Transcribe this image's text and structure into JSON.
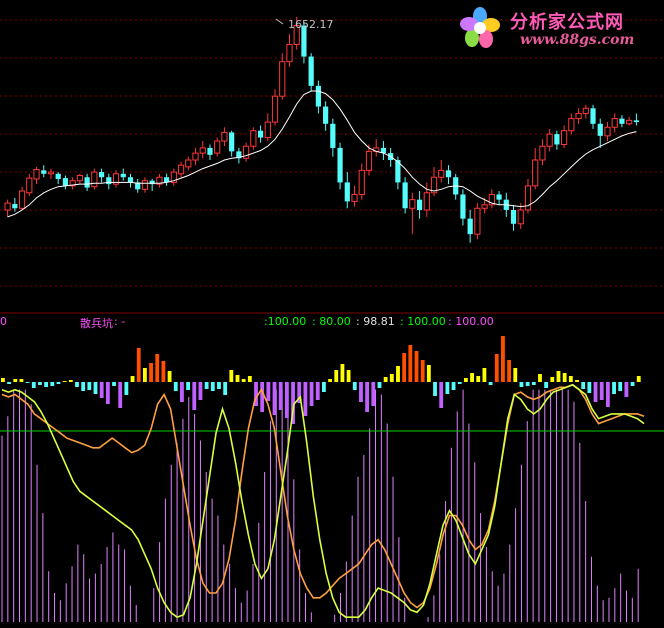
{
  "logo": {
    "title": "分析家公式网",
    "url": "www.88gs.com"
  },
  "price_panel": {
    "peak_label": "1652.17"
  },
  "indicator_header": {
    "left_value": "0",
    "name": "散兵坑",
    "sep": ": -",
    "values": [
      ":100.00",
      ": 80.00",
      ": 98.81",
      ": 100.00",
      ": 100.00"
    ]
  },
  "colors": {
    "up": "#ff3838",
    "down": "#54fcfc",
    "ma": "#ffffff",
    "grid": "#800000",
    "green_line": "#00d000",
    "bar_red": "#ff5000",
    "bar_yellow": "#ffff00",
    "bar_cyan": "#54fcfc",
    "bar_violet": "#c060ff",
    "histogram": "#e080ff",
    "line_yellow": "#d8ff40",
    "line_orange": "#ffa040",
    "hdr_name": "#ff50ff",
    "hdr_green": "#00ff00",
    "hdr_white": "#e0e0e0",
    "hdr_magenta": "#ff50ff"
  },
  "chart_data": [
    {
      "type": "candlestick",
      "title": "",
      "peak_annotation": 1652.17,
      "ylim": [
        1370,
        1660
      ],
      "candles": [
        [
          1428,
          1436,
          1420,
          1440
        ],
        [
          1435,
          1430,
          1426,
          1442
        ],
        [
          1430,
          1450,
          1428,
          1455
        ],
        [
          1448,
          1465,
          1444,
          1470
        ],
        [
          1464,
          1475,
          1458,
          1478
        ],
        [
          1474,
          1470,
          1466,
          1480
        ],
        [
          1470,
          1472,
          1464,
          1476
        ],
        [
          1470,
          1464,
          1458,
          1472
        ],
        [
          1465,
          1456,
          1452,
          1468
        ],
        [
          1456,
          1462,
          1452,
          1466
        ],
        [
          1462,
          1468,
          1458,
          1470
        ],
        [
          1466,
          1454,
          1450,
          1470
        ],
        [
          1455,
          1472,
          1452,
          1476
        ],
        [
          1472,
          1466,
          1460,
          1476
        ],
        [
          1466,
          1458,
          1452,
          1470
        ],
        [
          1458,
          1470,
          1454,
          1474
        ],
        [
          1470,
          1466,
          1462,
          1476
        ],
        [
          1466,
          1460,
          1454,
          1470
        ],
        [
          1460,
          1452,
          1448,
          1464
        ],
        [
          1452,
          1462,
          1448,
          1466
        ],
        [
          1462,
          1458,
          1450,
          1464
        ],
        [
          1458,
          1466,
          1454,
          1470
        ],
        [
          1466,
          1460,
          1456,
          1470
        ],
        [
          1460,
          1472,
          1456,
          1476
        ],
        [
          1470,
          1480,
          1466,
          1484
        ],
        [
          1478,
          1486,
          1474,
          1490
        ],
        [
          1486,
          1494,
          1480,
          1500
        ],
        [
          1494,
          1500,
          1488,
          1508
        ],
        [
          1500,
          1492,
          1486,
          1504
        ],
        [
          1494,
          1508,
          1490,
          1512
        ],
        [
          1508,
          1518,
          1502,
          1524
        ],
        [
          1518,
          1496,
          1490,
          1520
        ],
        [
          1496,
          1488,
          1482,
          1500
        ],
        [
          1488,
          1502,
          1484,
          1506
        ],
        [
          1502,
          1520,
          1498,
          1524
        ],
        [
          1520,
          1512,
          1506,
          1526
        ],
        [
          1512,
          1530,
          1508,
          1540
        ],
        [
          1530,
          1560,
          1526,
          1568
        ],
        [
          1560,
          1600,
          1556,
          1610
        ],
        [
          1600,
          1620,
          1594,
          1632
        ],
        [
          1620,
          1642,
          1614,
          1652
        ],
        [
          1642,
          1606,
          1598,
          1646
        ],
        [
          1606,
          1572,
          1566,
          1610
        ],
        [
          1572,
          1548,
          1540,
          1578
        ],
        [
          1548,
          1528,
          1520,
          1554
        ],
        [
          1528,
          1500,
          1490,
          1534
        ],
        [
          1500,
          1460,
          1452,
          1506
        ],
        [
          1460,
          1438,
          1430,
          1472
        ],
        [
          1438,
          1446,
          1432,
          1456
        ],
        [
          1446,
          1474,
          1440,
          1482
        ],
        [
          1474,
          1496,
          1468,
          1504
        ],
        [
          1496,
          1500,
          1490,
          1510
        ],
        [
          1500,
          1494,
          1486,
          1508
        ],
        [
          1494,
          1486,
          1478,
          1500
        ],
        [
          1486,
          1460,
          1452,
          1490
        ],
        [
          1460,
          1430,
          1424,
          1466
        ],
        [
          1430,
          1440,
          1400,
          1448
        ],
        [
          1440,
          1428,
          1418,
          1450
        ],
        [
          1428,
          1448,
          1420,
          1460
        ],
        [
          1448,
          1466,
          1444,
          1478
        ],
        [
          1466,
          1474,
          1460,
          1486
        ],
        [
          1474,
          1466,
          1458,
          1480
        ],
        [
          1466,
          1446,
          1440,
          1470
        ],
        [
          1446,
          1418,
          1410,
          1452
        ],
        [
          1418,
          1400,
          1390,
          1428
        ],
        [
          1400,
          1430,
          1394,
          1436
        ],
        [
          1430,
          1434,
          1424,
          1442
        ],
        [
          1434,
          1446,
          1430,
          1452
        ],
        [
          1446,
          1440,
          1434,
          1450
        ],
        [
          1440,
          1428,
          1420,
          1448
        ],
        [
          1428,
          1412,
          1404,
          1434
        ],
        [
          1412,
          1428,
          1406,
          1436
        ],
        [
          1428,
          1456,
          1424,
          1464
        ],
        [
          1456,
          1486,
          1452,
          1500
        ],
        [
          1486,
          1502,
          1480,
          1510
        ],
        [
          1502,
          1516,
          1496,
          1522
        ],
        [
          1516,
          1504,
          1498,
          1520
        ],
        [
          1504,
          1520,
          1500,
          1526
        ],
        [
          1520,
          1534,
          1516,
          1540
        ],
        [
          1534,
          1540,
          1528,
          1546
        ],
        [
          1540,
          1546,
          1534,
          1550
        ],
        [
          1546,
          1528,
          1522,
          1550
        ],
        [
          1528,
          1514,
          1500,
          1534
        ],
        [
          1514,
          1524,
          1508,
          1530
        ],
        [
          1524,
          1534,
          1518,
          1540
        ],
        [
          1534,
          1528,
          1524,
          1538
        ],
        [
          1528,
          1532,
          1526,
          1536
        ],
        [
          1532,
          1530,
          1526,
          1540
        ]
      ],
      "ma": [
        1420,
        1423,
        1428,
        1434,
        1442,
        1448,
        1452,
        1455,
        1456,
        1457,
        1458,
        1458,
        1459,
        1459,
        1460,
        1460,
        1460,
        1460,
        1459,
        1459,
        1459,
        1459,
        1460,
        1462,
        1465,
        1468,
        1472,
        1476,
        1479,
        1482,
        1486,
        1488,
        1489,
        1491,
        1494,
        1497,
        1502,
        1510,
        1522,
        1536,
        1551,
        1562,
        1566,
        1566,
        1563,
        1556,
        1545,
        1532,
        1518,
        1508,
        1500,
        1496,
        1494,
        1490,
        1484,
        1476,
        1466,
        1458,
        1452,
        1450,
        1452,
        1455,
        1456,
        1455,
        1450,
        1444,
        1440,
        1436,
        1434,
        1434,
        1433,
        1432,
        1433,
        1438,
        1446,
        1455,
        1462,
        1470,
        1478,
        1486,
        1493,
        1498,
        1502,
        1506,
        1510,
        1514,
        1517,
        1519
      ]
    },
    {
      "type": "bar_line",
      "title": "散兵坑",
      "ylim": [
        0,
        100
      ],
      "bars": [
        4,
        -2,
        3,
        3,
        -1,
        -6,
        -3,
        -5,
        -4,
        -2,
        1,
        2,
        -5,
        -9,
        -8,
        -12,
        -16,
        -22,
        -4,
        -26,
        -13,
        6,
        34,
        14,
        19,
        28,
        21,
        11,
        -9,
        -20,
        -8,
        -28,
        -18,
        -7,
        -9,
        -7,
        -13,
        12,
        7,
        3,
        6,
        -24,
        -30,
        -19,
        -33,
        -28,
        -36,
        -42,
        -21,
        -34,
        -24,
        -18,
        -10,
        3,
        12,
        18,
        12,
        -8,
        -20,
        -30,
        -24,
        -6,
        5,
        8,
        16,
        29,
        37,
        31,
        22,
        17,
        -14,
        -26,
        -12,
        -8,
        -2,
        4,
        9,
        6,
        14,
        -3,
        28,
        46,
        22,
        14,
        -5,
        -4,
        -3,
        8,
        -6,
        5,
        11,
        9,
        6,
        2,
        -7,
        -11,
        -20,
        -18,
        -25,
        -12,
        -9,
        -15,
        -4,
        6
      ],
      "hist": [
        77,
        85,
        96,
        96,
        96,
        90,
        65,
        45,
        21,
        12,
        9,
        16,
        23,
        32,
        28,
        18,
        20,
        24,
        31,
        37,
        32,
        30,
        15,
        7,
        0,
        0,
        14,
        33,
        51,
        65,
        74,
        84,
        93,
        86,
        75,
        62,
        51,
        44,
        32,
        24,
        14,
        8,
        13,
        24,
        41,
        62,
        83,
        96,
        96,
        85,
        59,
        30,
        12,
        4,
        0,
        0,
        0,
        3,
        12,
        25,
        44,
        60,
        69,
        80,
        96,
        94,
        82,
        60,
        35,
        10,
        0,
        0,
        0,
        2,
        11,
        28,
        50,
        72,
        87,
        96,
        82,
        66,
        45,
        31,
        21,
        15,
        20,
        32,
        47,
        65,
        83,
        96,
        96,
        96,
        96,
        96,
        96,
        96,
        91,
        74,
        50,
        27,
        15,
        9,
        10,
        14,
        20,
        13,
        10,
        22
      ],
      "line_yellow": [
        96,
        95,
        96,
        95,
        93,
        91,
        87,
        82,
        76,
        70,
        64,
        58,
        54,
        52,
        50,
        48,
        46,
        44,
        42,
        40,
        38,
        34,
        28,
        22,
        14,
        8,
        4,
        2,
        3,
        10,
        24,
        42,
        60,
        78,
        88,
        80,
        66,
        50,
        36,
        24,
        18,
        22,
        34,
        52,
        70,
        90,
        93,
        74,
        52,
        34,
        20,
        10,
        4,
        2,
        2,
        2,
        5,
        10,
        14,
        13,
        12,
        10,
        8,
        5,
        4,
        7,
        16,
        28,
        40,
        46,
        42,
        35,
        28,
        24,
        30,
        36,
        48,
        66,
        84,
        94,
        92,
        88,
        86,
        88,
        92,
        95,
        96,
        97,
        98,
        96,
        94,
        88,
        84,
        85,
        86,
        86,
        86,
        85,
        84,
        82
      ],
      "line_orange": [
        94,
        93,
        94,
        92,
        90,
        86,
        84,
        82,
        80,
        78,
        76,
        75,
        74,
        73,
        72,
        72,
        74,
        76,
        74,
        72,
        70,
        71,
        73,
        80,
        90,
        94,
        88,
        72,
        56,
        40,
        26,
        16,
        12,
        12,
        16,
        26,
        42,
        62,
        80,
        92,
        96,
        90,
        80,
        62,
        44,
        30,
        20,
        14,
        10,
        10,
        12,
        15,
        18,
        20,
        22,
        24,
        28,
        32,
        34,
        30,
        24,
        18,
        12,
        8,
        6,
        8,
        14,
        24,
        36,
        44,
        44,
        40,
        34,
        30,
        32,
        38,
        50,
        66,
        82,
        94,
        95,
        93,
        92,
        93,
        95,
        96,
        97,
        97,
        98,
        96,
        92,
        86,
        82,
        83,
        84,
        85,
        86,
        86,
        86,
        85
      ]
    }
  ]
}
